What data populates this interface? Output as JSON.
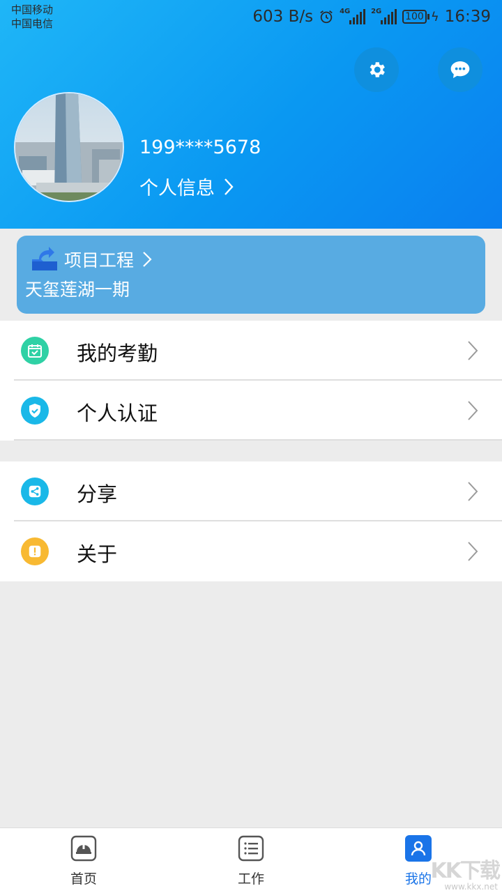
{
  "status_bar": {
    "carrier_1": "中国移动",
    "carrier_2": "中国电信",
    "net_speed": "603 B/s",
    "signal_1_tag": "4G",
    "signal_2_tag": "2G",
    "battery": "100",
    "time": "16:39"
  },
  "profile": {
    "phone": "199****5678",
    "info_link_label": "个人信息"
  },
  "project": {
    "title": "项目工程",
    "name": "天玺莲湖一期"
  },
  "menu_group_1": [
    {
      "label": "我的考勤",
      "icon": "calendar-check-icon",
      "color": "#2fd1a5"
    },
    {
      "label": "个人认证",
      "icon": "shield-check-icon",
      "color": "#1ab8e8"
    }
  ],
  "menu_group_2": [
    {
      "label": "分享",
      "icon": "share-icon",
      "color": "#1ab8e8"
    },
    {
      "label": "关于",
      "icon": "exclamation-icon",
      "color": "#f8b932"
    }
  ],
  "tabs": [
    {
      "label": "首页",
      "icon": "helmet-icon"
    },
    {
      "label": "工作",
      "icon": "list-icon"
    },
    {
      "label": "我的",
      "icon": "user-icon",
      "active": true
    }
  ],
  "watermark": {
    "text": "www.kkx.net",
    "big": "KK下载"
  },
  "colors": {
    "header_start": "#1fb6f7",
    "header_end": "#0a7ff0",
    "project_card": "#58abe2",
    "active_tab": "#1a74e8"
  }
}
